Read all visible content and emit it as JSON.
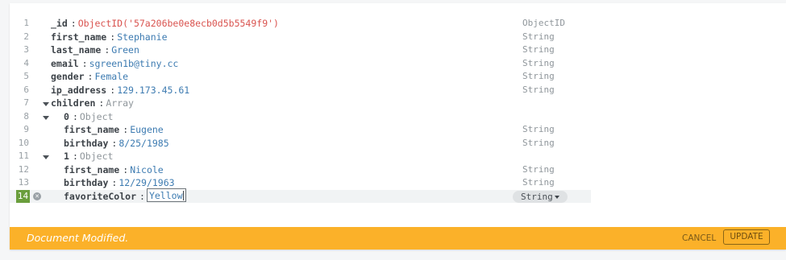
{
  "document": {
    "lines": [
      {
        "n": "1",
        "key": "_id",
        "value": "ObjectID('57a206be0e8ecb0d5b5549f9')",
        "type": "ObjectID"
      },
      {
        "n": "2",
        "key": "first_name",
        "value": "Stephanie",
        "type": "String"
      },
      {
        "n": "3",
        "key": "last_name",
        "value": "Green",
        "type": "String"
      },
      {
        "n": "4",
        "key": "email",
        "value": "sgreen1b@tiny.cc",
        "type": "String"
      },
      {
        "n": "5",
        "key": "gender",
        "value": "Female",
        "type": "String"
      },
      {
        "n": "6",
        "key": "ip_address",
        "value": "129.173.45.61",
        "type": "String"
      },
      {
        "n": "7",
        "key": "children",
        "value": "Array",
        "type": ""
      },
      {
        "n": "8",
        "key": "0",
        "value": "Object",
        "type": ""
      },
      {
        "n": "9",
        "key": "first_name",
        "value": "Eugene",
        "type": "String"
      },
      {
        "n": "10",
        "key": "birthday",
        "value": "8/25/1985",
        "type": "String"
      },
      {
        "n": "11",
        "key": "1",
        "value": "Object",
        "type": ""
      },
      {
        "n": "12",
        "key": "first_name",
        "value": "Nicole",
        "type": "String"
      },
      {
        "n": "13",
        "key": "birthday",
        "value": "12/29/1963",
        "type": "String"
      },
      {
        "n": "14",
        "key": "favoriteColor",
        "value": "Yellow",
        "type": "String"
      }
    ]
  },
  "colors": {
    "footer_background": "#fbb129",
    "active_line_number": "#6a9e3c",
    "string_value": "#3d7bb1",
    "objectid_value": "#d9534f"
  },
  "footer": {
    "message": "Document Modified.",
    "cancel_label": "CANCEL",
    "update_label": "UPDATE"
  }
}
